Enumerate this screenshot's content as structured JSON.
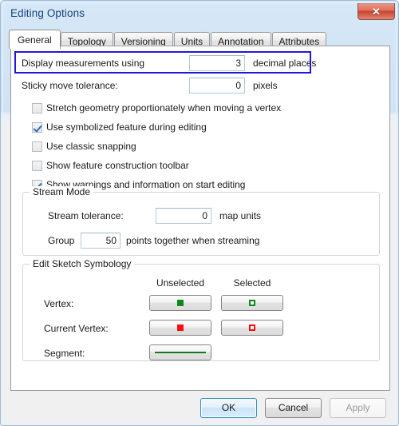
{
  "window": {
    "title": "Editing Options",
    "close_label": "Close",
    "close_icon": "close-icon"
  },
  "tabs": [
    {
      "label": "General",
      "active": true
    },
    {
      "label": "Topology",
      "active": false
    },
    {
      "label": "Versioning",
      "active": false
    },
    {
      "label": "Units",
      "active": false
    },
    {
      "label": "Annotation",
      "active": false
    },
    {
      "label": "Attributes",
      "active": false
    }
  ],
  "general": {
    "decimal_places": {
      "label": "Display measurements using",
      "value": "3",
      "suffix": "decimal places",
      "highlighted": true,
      "highlight_color": "#2018d8"
    },
    "sticky_move": {
      "label": "Sticky move tolerance:",
      "value": "0",
      "suffix": "pixels"
    },
    "checkboxes": [
      {
        "label": "Stretch geometry proportionately when moving a vertex",
        "checked": false
      },
      {
        "label": "Use symbolized feature during editing",
        "checked": true
      },
      {
        "label": "Use classic snapping",
        "checked": false
      },
      {
        "label": "Show feature construction toolbar",
        "checked": false
      },
      {
        "label": "Show warnings and information on start editing",
        "checked": true
      }
    ],
    "stream_mode": {
      "title": "Stream Mode",
      "tolerance_label": "Stream tolerance:",
      "tolerance_value": "0",
      "tolerance_suffix": "map units",
      "group_prefix": "Group",
      "group_value": "50",
      "group_suffix": "points together when streaming"
    },
    "sketch_symbology": {
      "title": "Edit Sketch Symbology",
      "column_unselected": "Unselected",
      "column_selected": "Selected",
      "row_vertex": "Vertex:",
      "row_current_vertex": "Current Vertex:",
      "row_segment": "Segment:",
      "symbols": {
        "vertex_unselected": "filled-green-square",
        "vertex_selected": "outline-green-square",
        "current_vertex_unselected": "filled-red-square",
        "current_vertex_selected": "outline-red-square",
        "segment_unselected": "green-line"
      },
      "colors": {
        "green": "#0a8a18",
        "red": "#f50f0f"
      }
    }
  },
  "footer": {
    "ok": "OK",
    "cancel": "Cancel",
    "apply": "Apply",
    "apply_disabled": true
  }
}
